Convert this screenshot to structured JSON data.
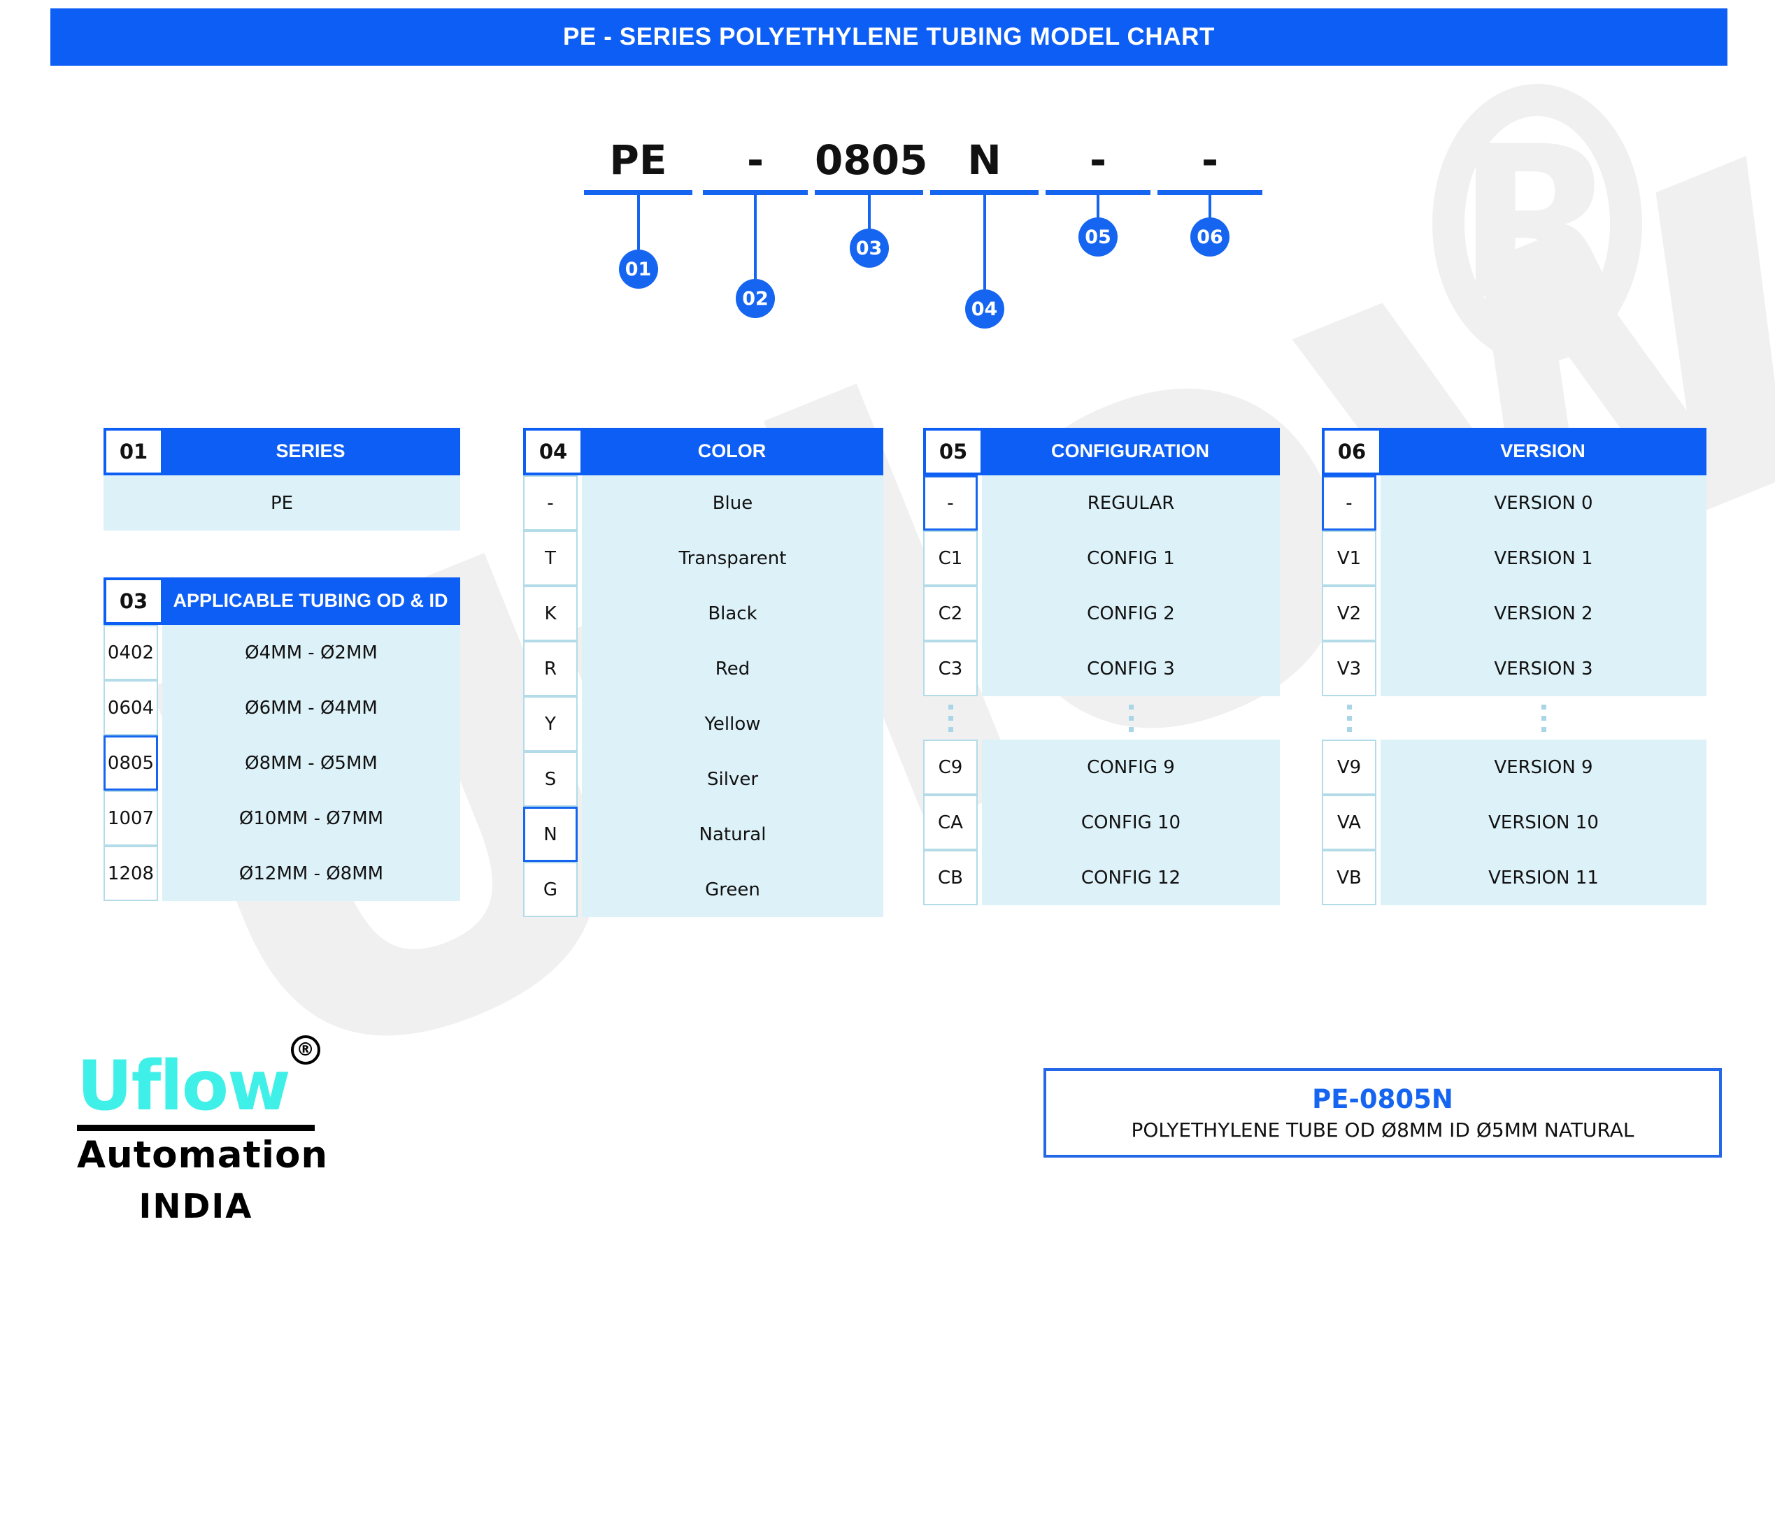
{
  "header": {
    "title": "PE - SERIES POLYETHYLENE TUBING MODEL CHART"
  },
  "model_code": {
    "segments": [
      {
        "glyph": "PE",
        "callout": "01"
      },
      {
        "glyph": "-",
        "callout": "02"
      },
      {
        "glyph": "0805",
        "callout": "03"
      },
      {
        "glyph": "N",
        "callout": "04"
      },
      {
        "glyph": "-",
        "callout": "05"
      },
      {
        "glyph": "-",
        "callout": "06"
      }
    ]
  },
  "tables": {
    "series": {
      "number": "01",
      "title": "SERIES",
      "rows": [
        {
          "code": "",
          "desc": "PE",
          "selected": false
        }
      ]
    },
    "tubing": {
      "number": "03",
      "title": "APPLICABLE TUBING OD & ID",
      "rows": [
        {
          "code": "0402",
          "desc": "Ø4MM -  Ø2MM",
          "selected": false
        },
        {
          "code": "0604",
          "desc": "Ø6MM -  Ø4MM",
          "selected": false
        },
        {
          "code": "0805",
          "desc": "Ø8MM -  Ø5MM",
          "selected": true
        },
        {
          "code": "1007",
          "desc": "Ø10MM -  Ø7MM",
          "selected": false
        },
        {
          "code": "1208",
          "desc": "Ø12MM -  Ø8MM",
          "selected": false
        }
      ]
    },
    "color": {
      "number": "04",
      "title": "COLOR",
      "rows": [
        {
          "code": "-",
          "desc": "Blue",
          "selected": false
        },
        {
          "code": "T",
          "desc": "Transparent",
          "selected": false
        },
        {
          "code": "K",
          "desc": "Black",
          "selected": false
        },
        {
          "code": "R",
          "desc": "Red",
          "selected": false
        },
        {
          "code": "Y",
          "desc": "Yellow",
          "selected": false
        },
        {
          "code": "S",
          "desc": "Silver",
          "selected": false
        },
        {
          "code": "N",
          "desc": "Natural",
          "selected": true
        },
        {
          "code": "G",
          "desc": "Green",
          "selected": false
        }
      ]
    },
    "configuration": {
      "number": "05",
      "title": "CONFIGURATION",
      "rows_top": [
        {
          "code": "-",
          "desc": "REGULAR",
          "selected": true
        },
        {
          "code": "C1",
          "desc": "CONFIG 1",
          "selected": false
        },
        {
          "code": "C2",
          "desc": "CONFIG 2",
          "selected": false
        },
        {
          "code": "C3",
          "desc": "CONFIG 3",
          "selected": false
        }
      ],
      "rows_bottom": [
        {
          "code": "C9",
          "desc": "CONFIG 9",
          "selected": false
        },
        {
          "code": "CA",
          "desc": "CONFIG 10",
          "selected": false
        },
        {
          "code": "CB",
          "desc": "CONFIG 12",
          "selected": false
        }
      ]
    },
    "version": {
      "number": "06",
      "title": "VERSION",
      "rows_top": [
        {
          "code": "-",
          "desc": "VERSION 0",
          "selected": true
        },
        {
          "code": "V1",
          "desc": "VERSION 1",
          "selected": false
        },
        {
          "code": "V2",
          "desc": "VERSION 2",
          "selected": false
        },
        {
          "code": "V3",
          "desc": "VERSION 3",
          "selected": false
        }
      ],
      "rows_bottom": [
        {
          "code": "V9",
          "desc": "VERSION 9",
          "selected": false
        },
        {
          "code": "VA",
          "desc": "VERSION 10",
          "selected": false
        },
        {
          "code": "VB",
          "desc": "VERSION 11",
          "selected": false
        }
      ]
    }
  },
  "logo": {
    "word": "Uflow",
    "registered": "®",
    "subtitle": "Automation",
    "country": "INDIA"
  },
  "result": {
    "code": "PE-0805N",
    "description": "POLYETHYLENE TUBE OD Ø8MM ID Ø5MM NATURAL"
  },
  "watermark": {
    "text": "Uflow",
    "registered": "R"
  },
  "colors": {
    "brand_blue": "#0d5ef4",
    "accent_blue": "#1565f0",
    "row_fill": "#ddf1f8",
    "row_border": "#b3dbe8",
    "logo_cyan": "#3ff0e8",
    "watermark_gray": "#f0f0f0"
  }
}
